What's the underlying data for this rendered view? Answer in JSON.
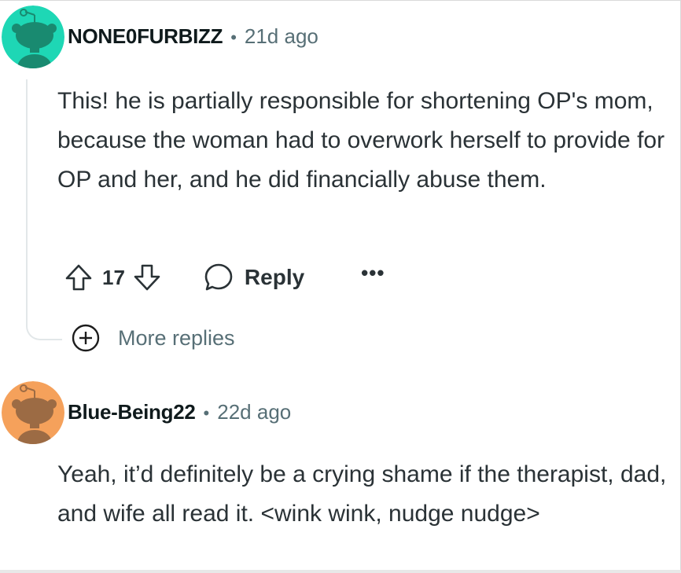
{
  "comments": [
    {
      "username": "NONE0FURBIZZ",
      "separator": "•",
      "time": "21d ago",
      "body": "This! he is partially responsible for shortening OP's mom, because the woman had to overwork herself to provide for OP and her, and he did financially abuse them.",
      "votes": "17",
      "reply_label": "Reply",
      "more_label": "•••",
      "more_replies_label": "More replies",
      "avatar_color": "#1ed7b5",
      "avatar_figure_color": "#198a70"
    },
    {
      "username": "Blue-Being22",
      "separator": "•",
      "time": "22d ago",
      "body": "Yeah, it’d definitely be a crying shame if the therapist, dad, and wife all read it. <wink wink, nudge nudge>",
      "avatar_color": "#f5a15b",
      "avatar_figure_color": "#9c6b44"
    }
  ],
  "icons": {
    "upvote": "upvote-arrow-icon",
    "downvote": "downvote-arrow-icon",
    "reply": "speech-bubble-icon",
    "expand": "plus-circle-icon"
  }
}
